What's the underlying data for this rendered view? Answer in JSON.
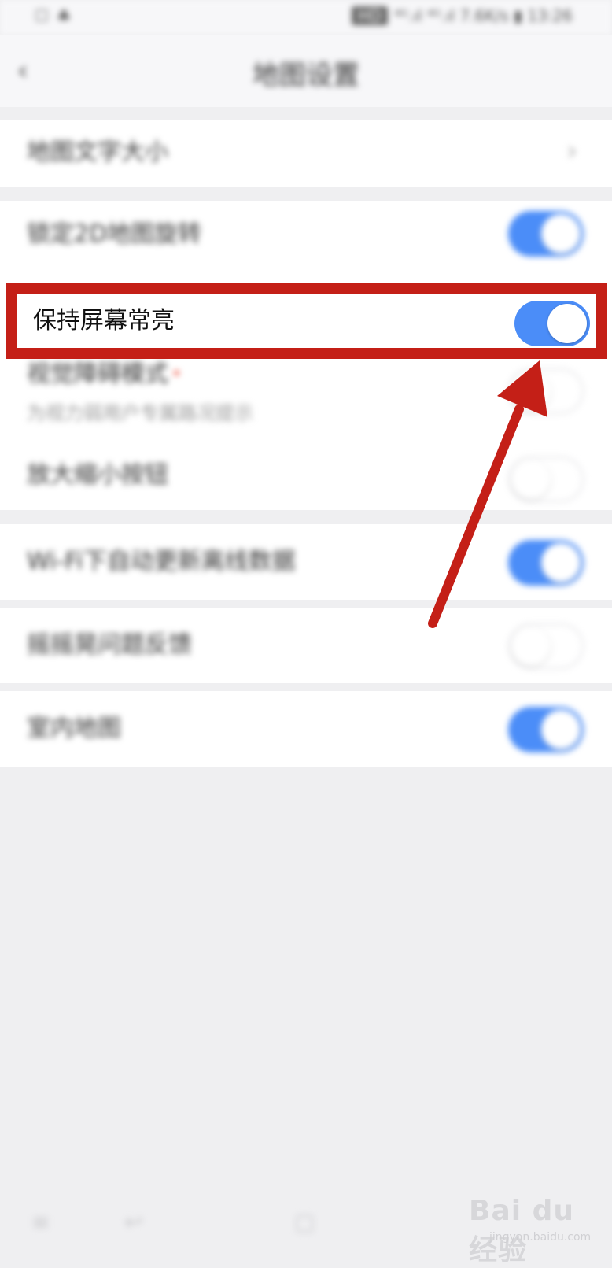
{
  "status_bar": {
    "left_text": "☐ ♣",
    "network_badge": "HD",
    "right_text": "⁴ᴳ.ıl ⁴ᴳ.ıl 7.6K/s ▮ 13:26"
  },
  "header": {
    "back_icon": "chevron-left-icon",
    "title": "地图设置"
  },
  "settings": {
    "map_text_size": {
      "label": "地图文字大小",
      "icon": "chevron-right-icon"
    },
    "lock_2d_rotation": {
      "label": "锁定2D地图旋转",
      "state": "on"
    },
    "keep_screen_on": {
      "label": "保持屏幕常亮",
      "state": "on"
    },
    "accessibility_mode": {
      "label": "视觉障碍模式",
      "badge": "•",
      "sub": "为视力弱用户专属路况提示",
      "state": "off"
    },
    "zoom_controls": {
      "label": "放大缩小按钮",
      "state": "off"
    },
    "wifi_offline_update": {
      "label": "Wi-Fi下自动更新离线数据",
      "state": "on"
    },
    "shake_feedback": {
      "label": "摇摇晃问题反馈",
      "state": "off"
    },
    "indoor_map": {
      "label": "室内地图",
      "state": "on"
    }
  },
  "annotation": {
    "color": "#c41f17"
  },
  "bottom_nav": {
    "icons": [
      "menu-icon",
      "back-icon",
      "home-icon"
    ],
    "glyphs": [
      "≡",
      "↩",
      "▢"
    ]
  },
  "watermark": {
    "brand": "Bai du 经验",
    "url": "jingyan.baidu.com"
  },
  "colors": {
    "toggle_on": "#4b8df8",
    "background": "#efeff1",
    "highlight_border": "#c41f17"
  }
}
